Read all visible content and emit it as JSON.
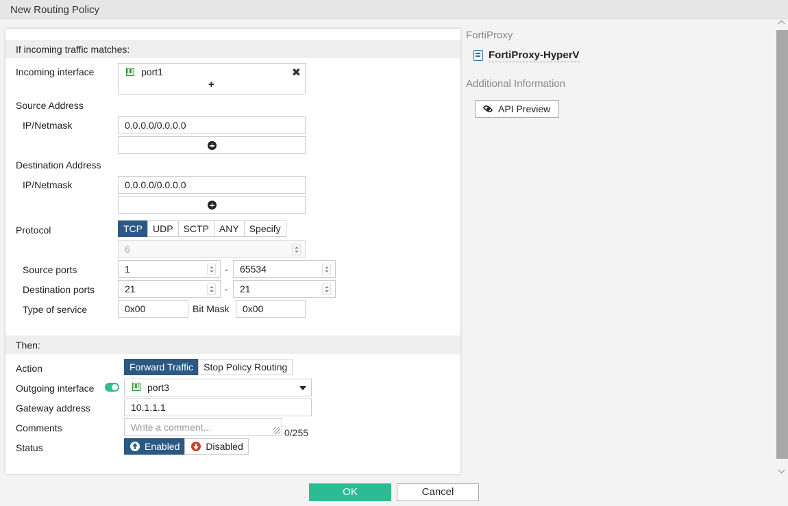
{
  "window": {
    "title": "New Routing Policy"
  },
  "match_section": {
    "heading": "If incoming traffic matches:",
    "incoming_interface": {
      "label": "Incoming interface",
      "value": "port1",
      "add_symbol": "+"
    },
    "source_address": {
      "label": "Source Address",
      "sublabel": "IP/Netmask",
      "value": "0.0.0.0/0.0.0.0"
    },
    "destination_address": {
      "label": "Destination Address",
      "sublabel": "IP/Netmask",
      "value": "0.0.0.0/0.0.0.0"
    },
    "protocol": {
      "label": "Protocol",
      "options": [
        "TCP",
        "UDP",
        "SCTP",
        "ANY",
        "Specify"
      ],
      "selected": "TCP",
      "number": "6"
    },
    "source_ports": {
      "label": "Source ports",
      "from": "1",
      "dash": "-",
      "to": "65534"
    },
    "destination_ports": {
      "label": "Destination ports",
      "from": "21",
      "dash": "-",
      "to": "21"
    },
    "type_of_service": {
      "label": "Type of service",
      "value": "0x00",
      "bitmask_label": "Bit Mask",
      "bitmask_value": "0x00"
    }
  },
  "then_section": {
    "heading": "Then:",
    "action": {
      "label": "Action",
      "options": [
        "Forward Traffic",
        "Stop Policy Routing"
      ],
      "selected": "Forward Traffic"
    },
    "outgoing_interface": {
      "label": "Outgoing interface",
      "enabled": true,
      "value": "port3"
    },
    "gateway_address": {
      "label": "Gateway address",
      "value": "10.1.1.1"
    },
    "comments": {
      "label": "Comments",
      "placeholder": "Write a comment...",
      "counter": "0/255"
    },
    "status": {
      "label": "Status",
      "options": [
        "Enabled",
        "Disabled"
      ],
      "selected": "Enabled"
    }
  },
  "side_panel": {
    "product_heading": "FortiProxy",
    "device_name": "FortiProxy-HyperV",
    "additional_heading": "Additional Information",
    "api_preview_label": "API Preview"
  },
  "footer": {
    "ok_label": "OK",
    "cancel_label": "Cancel"
  },
  "colors": {
    "accent": "#2b5983",
    "ok_button": "#2dbb94",
    "toggle": "#2dbb94",
    "enabled_icon": "#2b5983",
    "disabled_icon": "#d03a2b"
  }
}
